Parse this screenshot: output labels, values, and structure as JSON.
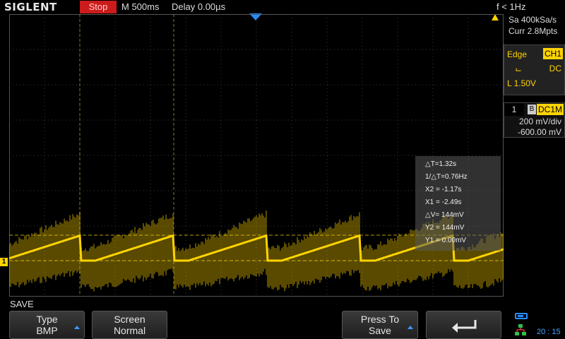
{
  "header": {
    "brand": "SIGLENT",
    "run_state": "Stop",
    "timebase": "M 500ms",
    "delay": "Delay 0.00µs",
    "frequency": "f < 1Hz"
  },
  "acquisition": {
    "sample_rate": "Sa 400kSa/s",
    "memory_depth": "Curr 2.8Mpts"
  },
  "trigger": {
    "type": "Edge",
    "source": "CH1",
    "slope_icon": "rising-edge-icon",
    "coupling": "DC",
    "level": "L  1.50V"
  },
  "channel": {
    "number": "1",
    "bw_limit": "B",
    "impedance": "DC1M",
    "scale": "200 mV/div",
    "offset": "-600.00 mV",
    "marker": "1",
    "color": "#ffd400"
  },
  "cursors": {
    "delta_t": "△T=1.32s",
    "inv_delta_t": "1/△T=0.76Hz",
    "x2": "X2 = -1.17s",
    "x1": "X1 = -2.49s",
    "delta_v": "△V= 144mV",
    "y2": "Y2 = 144mV",
    "y1": "Y1 = 0.00mV"
  },
  "menu": {
    "title": "SAVE",
    "softkeys": [
      {
        "line1": "Type",
        "line2": "BMP"
      },
      {
        "line1": "Screen",
        "line2": "Normal"
      },
      {
        "line1": "Press To",
        "line2": "Save"
      }
    ],
    "back_icon": "return-arrow-icon"
  },
  "status": {
    "usb_icon": "usb-icon",
    "network_icon": "network-icon",
    "clock": "20 : 15"
  },
  "waveform": {
    "period_s": 1.32,
    "ramp_low_mV": 0,
    "ramp_high_mV": 144
  }
}
